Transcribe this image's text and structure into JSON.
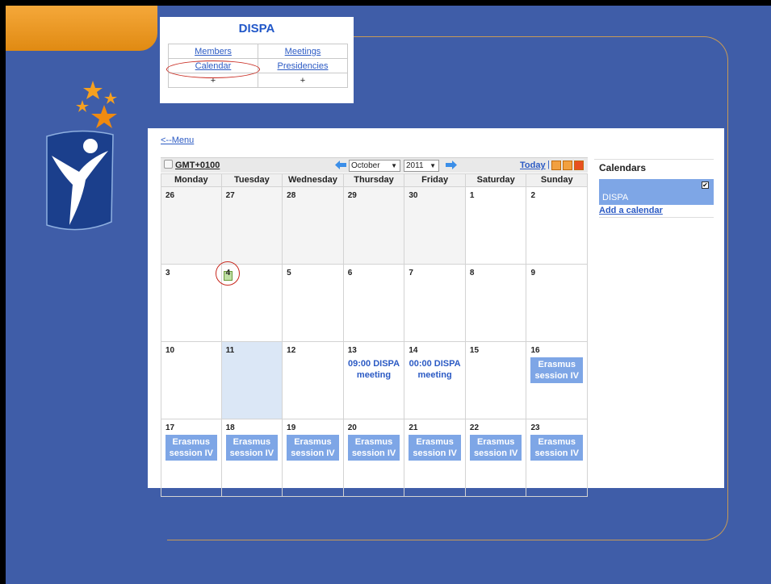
{
  "menu": {
    "title": "DISPA",
    "links": [
      "Members",
      "Meetings",
      "Calendar",
      "Presidencies"
    ],
    "plus": [
      "+",
      "+"
    ]
  },
  "calendar": {
    "back_link": "<--Menu",
    "timezone": "GMT+0100",
    "month": "October",
    "year": "2011",
    "today_label": "Today",
    "today_sep": "|",
    "weekdays": [
      "Monday",
      "Tuesday",
      "Wednesday",
      "Thursday",
      "Friday",
      "Saturday",
      "Sunday"
    ],
    "weeks": [
      [
        {
          "n": "26",
          "other": true
        },
        {
          "n": "27",
          "other": true
        },
        {
          "n": "28",
          "other": true
        },
        {
          "n": "29",
          "other": true
        },
        {
          "n": "30",
          "other": true
        },
        {
          "n": "1"
        },
        {
          "n": "2"
        }
      ],
      [
        {
          "n": "3"
        },
        {
          "n": "4"
        },
        {
          "n": "5"
        },
        {
          "n": "6"
        },
        {
          "n": "7"
        },
        {
          "n": "8"
        },
        {
          "n": "9"
        }
      ],
      [
        {
          "n": "10"
        },
        {
          "n": "11",
          "today": true
        },
        {
          "n": "12"
        },
        {
          "n": "13",
          "text": "09:00 DISPA meeting"
        },
        {
          "n": "14",
          "text": "00:00 DISPA meeting"
        },
        {
          "n": "15"
        },
        {
          "n": "16",
          "block": "Erasmus session IV"
        }
      ],
      [
        {
          "n": "17",
          "block": "Erasmus session IV"
        },
        {
          "n": "18",
          "block": "Erasmus session IV"
        },
        {
          "n": "19",
          "block": "Erasmus session IV"
        },
        {
          "n": "20",
          "block": "Erasmus session IV"
        },
        {
          "n": "21",
          "block": "Erasmus session IV"
        },
        {
          "n": "22",
          "block": "Erasmus session IV"
        },
        {
          "n": "23",
          "block": "Erasmus session IV"
        }
      ]
    ]
  },
  "side": {
    "title": "Calendars",
    "calendar_name": "DISPA",
    "checkmark": "✔",
    "add_calendar": "Add a calendar"
  },
  "colors": {
    "background": "#3f5da8",
    "event_block": "#7ea6e6",
    "link": "#2b5ac4",
    "highlight": "#c8281e"
  }
}
